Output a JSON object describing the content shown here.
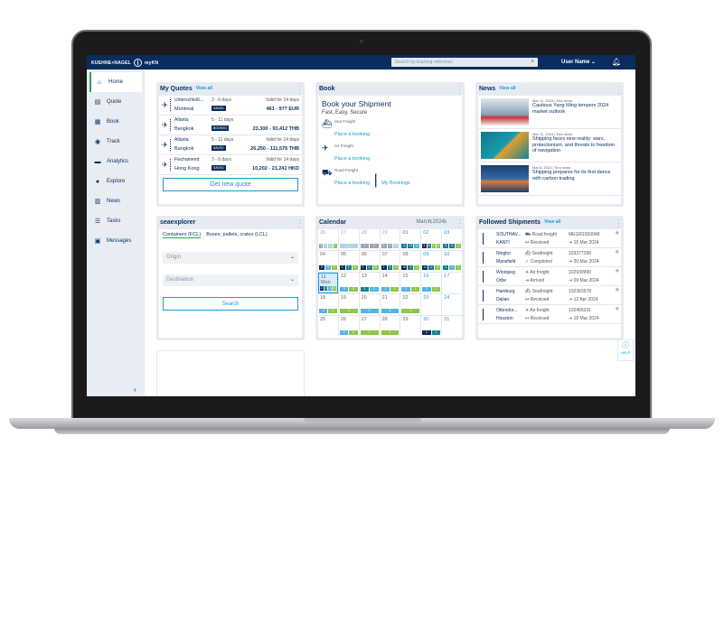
{
  "header": {
    "brand": "KUEHNE+NAGEL",
    "app": "myKN",
    "search_placeholder": "Search by tracking reference",
    "user": "User Name"
  },
  "sidebar": {
    "items": [
      {
        "label": "Home",
        "icon": "⌂",
        "active": true
      },
      {
        "label": "Quote",
        "icon": "▤"
      },
      {
        "label": "Book",
        "icon": "▦"
      },
      {
        "label": "Track",
        "icon": "◉"
      },
      {
        "label": "Analytics",
        "icon": "▬"
      },
      {
        "label": "Explore",
        "icon": "●"
      },
      {
        "label": "News",
        "icon": "▥"
      },
      {
        "label": "Tasks",
        "icon": "☰"
      },
      {
        "label": "Messages",
        "icon": "▣"
      }
    ]
  },
  "quotes": {
    "title": "My Quotes",
    "view_all": "View all",
    "button": "Get new quote",
    "items": [
      {
        "origin": "Unterschleiß...",
        "dest": "Montreal",
        "duration": "3 - 6 days",
        "status": "SAVED",
        "validity": "Valid for 14 days",
        "price": "461 - 977 EUR"
      },
      {
        "origin": "Atlanta",
        "dest": "Bangkok",
        "duration": "5 - 11 days",
        "status": "BOOKED",
        "validity": "",
        "price": "23,300 - 93,412 THB"
      },
      {
        "origin": "Atlanta",
        "dest": "Bangkok",
        "duration": "5 - 11 days",
        "status": "SAVED",
        "validity": "Valid for 14 days",
        "price": "26,250 - 111,576 THB"
      },
      {
        "origin": "Fischamend",
        "dest": "Hong Kong",
        "duration": "3 - 6 days",
        "status": "SAVED",
        "validity": "Valid for 14 days",
        "price": "10,202 - 21,241 HKD"
      }
    ]
  },
  "book": {
    "title": "Book",
    "heading": "Book your Shipment",
    "sub": "Fast, Easy, Secure",
    "items": [
      {
        "icon": "ship",
        "label": "Sea Freight",
        "link": "Place a booking"
      },
      {
        "icon": "plane",
        "label": "Air Freight",
        "link": "Place a booking"
      },
      {
        "icon": "truck",
        "label": "Road Freight",
        "link": "Place a booking",
        "extra": "My Bookings"
      }
    ]
  },
  "news": {
    "title": "News",
    "view_all": "View all",
    "items": [
      {
        "date": "Mar 11, 2024",
        "cat": "Sea news",
        "title": "Cautious Yang Ming tempers 2024 market outlook"
      },
      {
        "date": "Mar 11, 2024",
        "cat": "Sea news",
        "title": "Shipping faces new reality: wars, protectionism, and threats to freedom of navigation"
      },
      {
        "date": "Mar 8, 2024",
        "cat": "Sea news",
        "title": "Shipping prepares for its first dance with carbon trading"
      }
    ]
  },
  "seaexplorer": {
    "title": "seaexplorer",
    "tabs": [
      "Containers (FCL)",
      "Boxes, pallets, crates (LCL)"
    ],
    "origin": "Origin",
    "destination": "Destination",
    "button": "Search"
  },
  "calendar": {
    "title": "Calendar",
    "month": "March 2024",
    "colors": {
      "g": "#9aa6b2",
      "l": "#a9d6e8",
      "d": "#0a2d5e",
      "t": "#1a7d8c",
      "b": "#56b4e3",
      "n": "#8cc84b"
    },
    "days": [
      {
        "d": "26",
        "m": 1,
        "s": [
          [
            "3",
            "g"
          ],
          [
            "1",
            "l"
          ],
          [
            "2",
            "l"
          ],
          [
            "1",
            "n"
          ]
        ]
      },
      {
        "d": "27",
        "m": 1,
        "s": [
          [
            "1",
            "l"
          ]
        ]
      },
      {
        "d": "28",
        "m": 1,
        "s": [
          [
            "1",
            "g"
          ],
          [
            "2",
            "g"
          ]
        ]
      },
      {
        "d": "29",
        "m": 1,
        "s": [
          [
            "1",
            "g"
          ],
          [
            "2",
            "g"
          ],
          [
            "1",
            "l"
          ]
        ]
      },
      {
        "d": "01",
        "s": [
          [
            "1",
            "t"
          ],
          [
            "13",
            "t"
          ],
          [
            "1",
            "b"
          ]
        ]
      },
      {
        "d": "02",
        "w": 1,
        "s": [
          [
            "4",
            "d"
          ],
          [
            "3",
            "t"
          ],
          [
            "1",
            "n"
          ],
          [
            "5",
            "n"
          ]
        ]
      },
      {
        "d": "03",
        "w": 1,
        "s": [
          [
            "3",
            "t"
          ],
          [
            "2",
            "t"
          ],
          [
            "1",
            "n"
          ]
        ]
      },
      {
        "d": "04",
        "s": [
          [
            "4",
            "d"
          ],
          [
            "5",
            "b"
          ],
          [
            "1",
            "n"
          ]
        ]
      },
      {
        "d": "05",
        "s": [
          [
            "1",
            "d"
          ],
          [
            "1",
            "t"
          ],
          [
            "3",
            "n"
          ]
        ]
      },
      {
        "d": "06",
        "s": [
          [
            "1",
            "d"
          ],
          [
            "4",
            "t"
          ],
          [
            "3",
            "n"
          ]
        ]
      },
      {
        "d": "07",
        "s": [
          [
            "1",
            "d"
          ],
          [
            "1",
            "t"
          ],
          [
            "3",
            "n"
          ]
        ]
      },
      {
        "d": "08",
        "s": [
          [
            "10",
            "d"
          ],
          [
            "1",
            "t"
          ],
          [
            "1",
            "n"
          ]
        ]
      },
      {
        "d": "09",
        "w": 1,
        "s": [
          [
            "11",
            "d"
          ],
          [
            "1",
            "t"
          ],
          [
            "1",
            "n"
          ]
        ]
      },
      {
        "d": "10",
        "w": 1,
        "s": [
          [
            "1",
            "t"
          ],
          [
            "1",
            "b"
          ],
          [
            "1",
            "n"
          ]
        ]
      },
      {
        "d": "11 Mon",
        "today": 1,
        "s": [
          [
            "2",
            "d"
          ],
          [
            "1",
            "t"
          ],
          [
            "1",
            "b"
          ],
          [
            "3",
            "n"
          ]
        ]
      },
      {
        "d": "12",
        "s": [
          [
            "3",
            "b"
          ],
          [
            "3",
            "n"
          ]
        ]
      },
      {
        "d": "13",
        "s": [
          [
            "1",
            "t"
          ],
          [
            "1",
            "b"
          ]
        ]
      },
      {
        "d": "14",
        "s": [
          [
            "1",
            "b"
          ],
          [
            "1",
            "n"
          ]
        ]
      },
      {
        "d": "15",
        "s": [
          [
            "1",
            "b"
          ],
          [
            "1",
            "n"
          ]
        ]
      },
      {
        "d": "16",
        "w": 1,
        "s": [
          [
            "1",
            "b"
          ],
          [
            "2",
            "n"
          ]
        ]
      },
      {
        "d": "17",
        "w": 1,
        "s": []
      },
      {
        "d": "18",
        "s": [
          [
            "4",
            "b"
          ],
          [
            "3",
            "n"
          ]
        ]
      },
      {
        "d": "19",
        "s": [
          [
            "4",
            "n"
          ]
        ]
      },
      {
        "d": "20",
        "s": [
          [
            "4",
            "b"
          ]
        ]
      },
      {
        "d": "21",
        "s": [
          [
            "3",
            "b"
          ]
        ]
      },
      {
        "d": "22",
        "s": [
          [
            "3",
            "n"
          ]
        ]
      },
      {
        "d": "23",
        "w": 1,
        "s": []
      },
      {
        "d": "24",
        "w": 1,
        "s": []
      },
      {
        "d": "25",
        "s": []
      },
      {
        "d": "26",
        "s": [
          [
            "2",
            "b"
          ],
          [
            "3",
            "n"
          ]
        ]
      },
      {
        "d": "27",
        "s": [
          [
            "1",
            "n"
          ]
        ]
      },
      {
        "d": "28",
        "s": [
          [
            "1",
            "n"
          ]
        ]
      },
      {
        "d": "29",
        "s": []
      },
      {
        "d": "30",
        "w": 1,
        "s": [
          [
            "1",
            "d"
          ],
          [
            "1",
            "t"
          ]
        ]
      },
      {
        "d": "31",
        "w": 1,
        "s": []
      }
    ]
  },
  "shipments": {
    "title": "Followed Shipments",
    "view_all": "View all",
    "items": [
      {
        "from": "SOUTHAV...",
        "to": "KANTI",
        "mode": "Road freight",
        "status": "Received",
        "ref": "MEGR1550048",
        "date": "16 Mar 2024"
      },
      {
        "from": "Ningbo",
        "to": "Mansfield",
        "mode": "Seafreight",
        "status": "Completed",
        "ref": "103377396",
        "date": "20 Mar 2024"
      },
      {
        "from": "Winnipeg",
        "to": "Orbe",
        "mode": "Air freight",
        "status": "Arrived",
        "ref": "102930990",
        "date": "09 Mar 2024"
      },
      {
        "from": "Hamburg",
        "to": "Dalian",
        "mode": "Seafreight",
        "status": "Received",
        "ref": "102363578",
        "date": "12 Apr 2024"
      },
      {
        "from": "Ottendor...",
        "to": "Houston",
        "mode": "Air freight",
        "status": "Received",
        "ref": "102465331",
        "date": "18 Mar 2024"
      }
    ]
  },
  "help": {
    "label": "HELP"
  }
}
